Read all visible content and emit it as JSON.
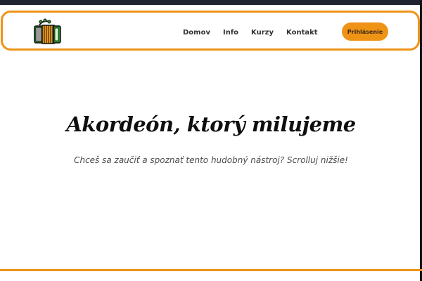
{
  "header": {
    "logo": {
      "icon": "accordion-icon"
    },
    "nav": {
      "items": [
        {
          "label": "Domov"
        },
        {
          "label": "Info"
        },
        {
          "label": "Kurzy"
        },
        {
          "label": "Kontakt"
        }
      ]
    },
    "login_button": "Prihlásenie"
  },
  "hero": {
    "title": "Akordeón, ktorý milujeme",
    "subtitle": "Chceš sa zaučiť a spoznať tento hudobný nástroj? Scrolluj nižšie!"
  },
  "theme": {
    "accent": "#ef9317",
    "text": "#0f0f0f",
    "subtle_text": "#4b4b4b",
    "background": "#ffffff"
  }
}
